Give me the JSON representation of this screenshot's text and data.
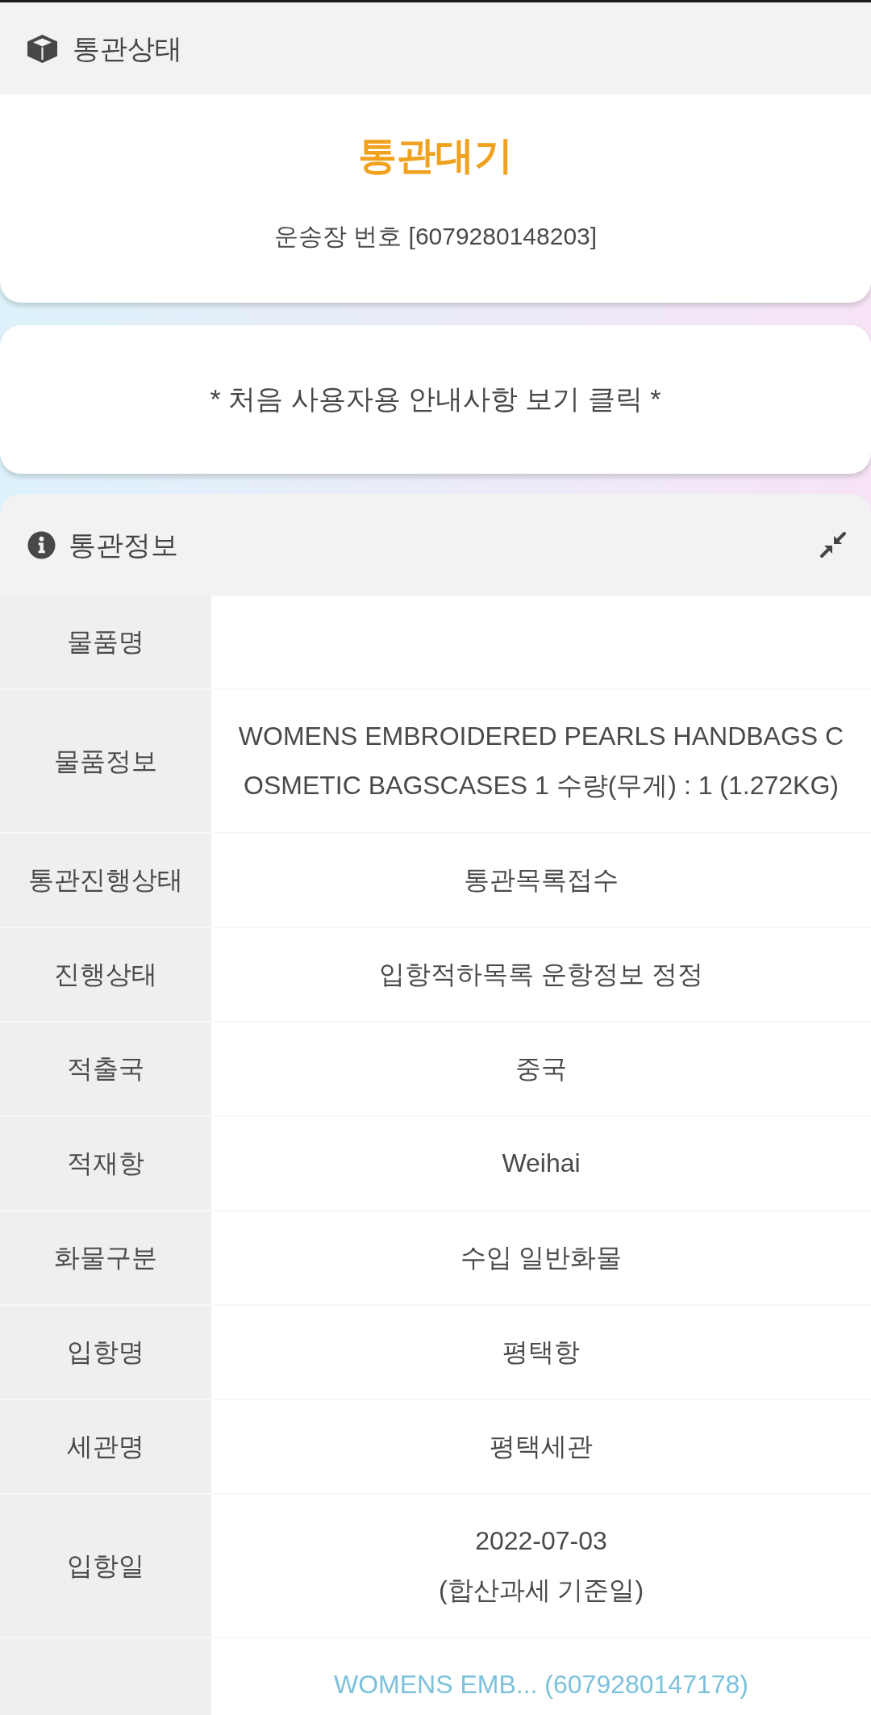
{
  "status_header": {
    "title": "통관상태"
  },
  "status_card": {
    "status": "통관대기",
    "tracking": "운송장 번호 [6079280148203]"
  },
  "notice_button": {
    "label": "* 처음 사용자용 안내사항 보기 클릭 *"
  },
  "info_section": {
    "title": "통관정보",
    "expanded": true,
    "rows": [
      {
        "kind": "text",
        "label": "물품명"
      },
      {
        "kind": "text",
        "label": "물품정보",
        "value": "WOMENS EMBROIDERED PEARLS HANDBAGS COSMETIC BAGSCASES 1 수량(무게) : 1 (1.272KG)"
      },
      {
        "kind": "text",
        "label": "통관진행상태",
        "value": "통관목록접수"
      },
      {
        "kind": "text",
        "label": "진행상태",
        "value": "입항적하목록 운항정보 정정"
      },
      {
        "kind": "text",
        "label": "적출국",
        "value": "중국"
      },
      {
        "kind": "text",
        "label": "적재항",
        "value": "Weihai"
      },
      {
        "kind": "text",
        "label": "화물구분",
        "value": "수입 일반화물"
      },
      {
        "kind": "text",
        "label": "입항명",
        "value": "평택항"
      },
      {
        "kind": "text",
        "label": "세관명",
        "value": "평택세관"
      },
      {
        "kind": "text",
        "label": "입항일",
        "value": "2022-07-03",
        "note": "(합산과세 기준일)"
      },
      {
        "kind": "link",
        "value": "WOMENS EMB... (6079280147178)"
      }
    ]
  }
}
